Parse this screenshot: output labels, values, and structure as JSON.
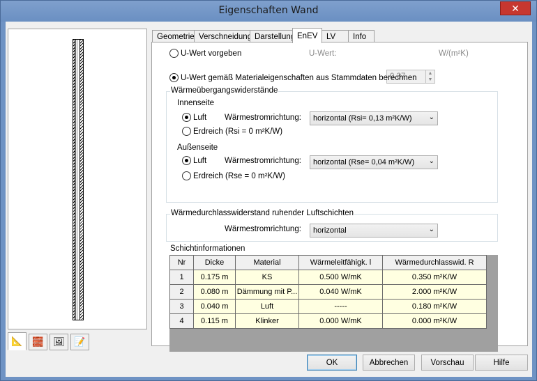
{
  "window": {
    "title": "Eigenschaften Wand",
    "close_glyph": "✕"
  },
  "tabs": [
    {
      "label": "Geometrie"
    },
    {
      "label": "Verschneidung"
    },
    {
      "label": "Darstellung"
    },
    {
      "label": "EnEV",
      "active": true
    },
    {
      "label": "LV"
    },
    {
      "label": "Info"
    }
  ],
  "left_tabs": [
    {
      "icon": "ruler-pencil-icon",
      "glyph": "📐"
    },
    {
      "icon": "bricks-icon",
      "glyph": "🧱"
    },
    {
      "icon": "image-icon",
      "glyph": "🖼"
    },
    {
      "icon": "notepad-icon",
      "glyph": "📝"
    }
  ],
  "uwert": {
    "radio_vorgeben": "U-Wert vorgeben",
    "label": "U-Wert:",
    "value": "0.37",
    "unit": "W/(m²K)",
    "radio_berechnen": "U-Wert gemäß Materialeigenschaften aus Stammdaten berechnen",
    "selected": "berechnen"
  },
  "uebergang": {
    "title": "Wärmeübergangswiderstände",
    "innen": {
      "title": "Innenseite",
      "luft": "Luft",
      "erdreich": "Erdreich (Rsi = 0 m²K/W)",
      "richtung_label": "Wärmestromrichtung:",
      "richtung_value": "horizontal (Rsi= 0,13 m²K/W)"
    },
    "aussen": {
      "title": "Außenseite",
      "luft": "Luft",
      "erdreich": "Erdreich (Rse = 0 m²K/W)",
      "richtung_label": "Wärmestromrichtung:",
      "richtung_value": "horizontal (Rse= 0,04 m²K/W)"
    }
  },
  "luftschichten": {
    "title": "Wärmedurchlasswiderstand ruhender Luftschichten",
    "richtung_label": "Wärmestromrichtung:",
    "richtung_value": "horizontal"
  },
  "schichten": {
    "title": "Schichtinformationen",
    "columns": [
      "Nr",
      "Dicke",
      "Material",
      "Wärmeleitfähigk. l",
      "Wärmedurchlasswid. R"
    ],
    "rows": [
      [
        "1",
        "0.175 m",
        "KS",
        "0.500 W/mK",
        "0.350 m²K/W"
      ],
      [
        "2",
        "0.080 m",
        "Dämmung mit P...",
        "0.040 W/mK",
        "2.000 m²K/W"
      ],
      [
        "3",
        "0.040 m",
        "Luft",
        "-----",
        "0.180 m²K/W"
      ],
      [
        "4",
        "0.115 m",
        "Klinker",
        "0.000 W/mK",
        "0.000 m²K/W"
      ]
    ]
  },
  "buttons": {
    "ok": "OK",
    "abbrechen": "Abbrechen",
    "vorschau": "Vorschau",
    "hilfe": "Hilfe"
  },
  "colors": {
    "titlebar": "#7fa0cd",
    "close": "#c7372f",
    "cell_bg": "#ffffe1",
    "table_bg": "#a0a0a0"
  }
}
